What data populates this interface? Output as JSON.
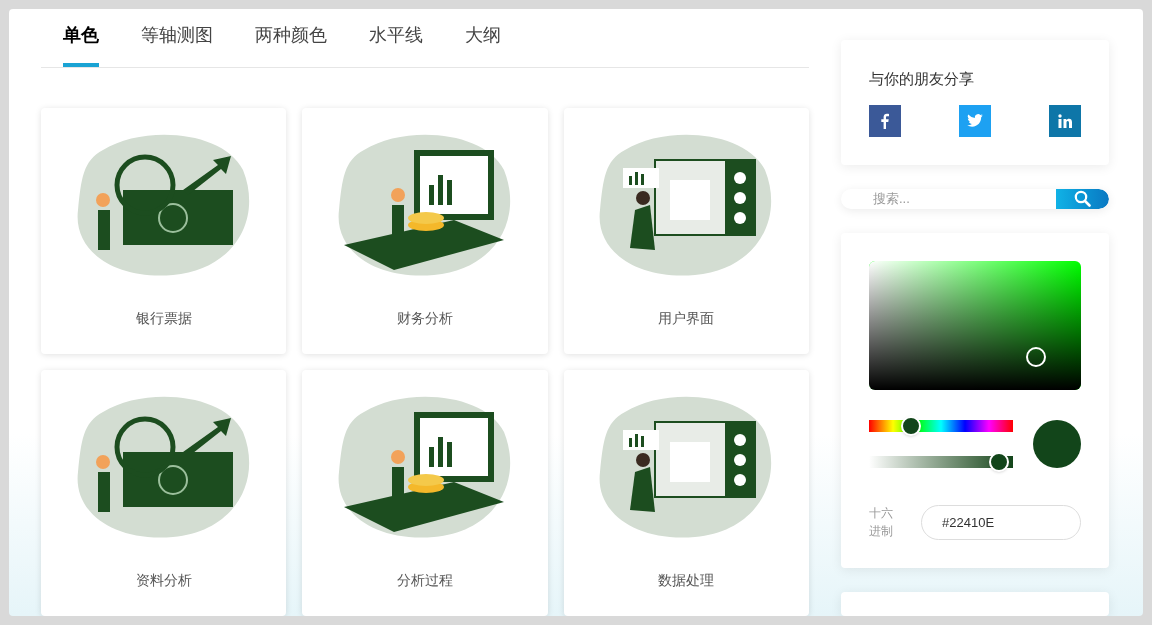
{
  "tabs": [
    {
      "label": "单色",
      "selected": true
    },
    {
      "label": "等轴测图",
      "selected": false
    },
    {
      "label": "两种颜色",
      "selected": false
    },
    {
      "label": "水平线",
      "selected": false
    },
    {
      "label": "大纲",
      "selected": false
    }
  ],
  "cards": [
    {
      "caption": "银行票据"
    },
    {
      "caption": "财务分析"
    },
    {
      "caption": "用户界面"
    },
    {
      "caption": "资料分析"
    },
    {
      "caption": "分析过程"
    },
    {
      "caption": "数据处理"
    }
  ],
  "share": {
    "title": "与你的朋友分享"
  },
  "search": {
    "placeholder": "搜索..."
  },
  "color_picker": {
    "hue": {
      "level": 0.26
    },
    "opacity": {
      "level": 0.97
    },
    "hex_label": "十六进制",
    "hex_value": "#22410E"
  }
}
